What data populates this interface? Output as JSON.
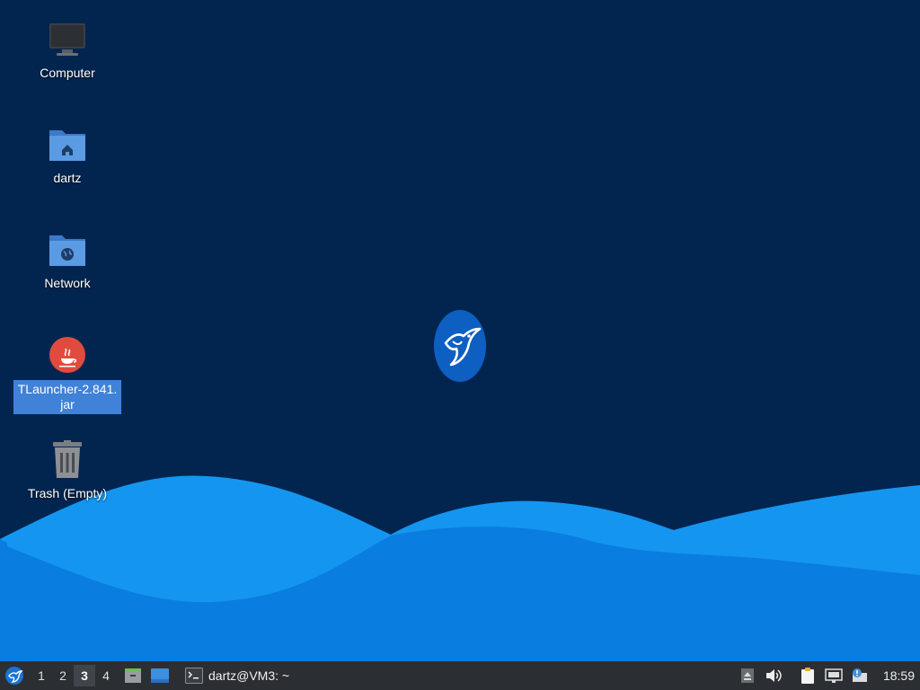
{
  "desktop": {
    "icons": [
      {
        "label": "Computer"
      },
      {
        "label": "dartz"
      },
      {
        "label": "Network"
      },
      {
        "label": "TLauncher-2.841.\njar",
        "selected": true
      },
      {
        "label": "Trash (Empty)"
      }
    ],
    "colors": {
      "background": "#022550",
      "wave_dark": "#1496f0",
      "wave_light": "#0a7de0",
      "selection": "#3f82d8"
    }
  },
  "taskbar": {
    "workspaces": [
      "1",
      "2",
      "3",
      "4"
    ],
    "active_workspace": "3",
    "task_label": "dartz@VM3: ~",
    "clock": "18:59",
    "tray_icons": [
      "eject-icon",
      "volume-icon",
      "clipboard-icon",
      "network-icon",
      "notification-icon"
    ]
  }
}
